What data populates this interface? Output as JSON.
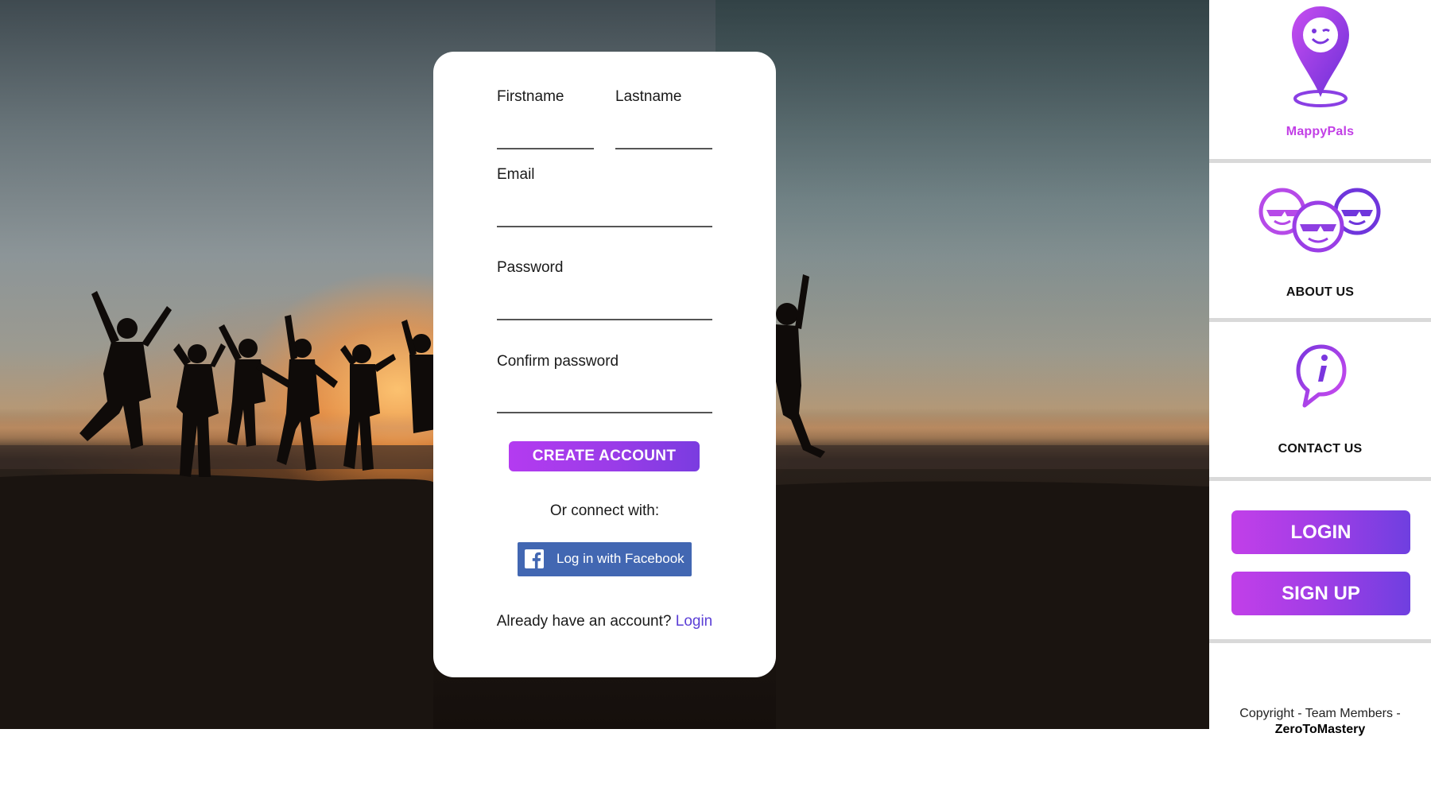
{
  "form": {
    "firstname_label": "Firstname",
    "lastname_label": "Lastname",
    "email_label": "Email",
    "password_label": "Password",
    "confirm_label": "Confirm password",
    "firstname_value": "",
    "lastname_value": "",
    "email_value": "",
    "password_value": "",
    "confirm_value": "",
    "create_button": "CREATE ACCOUNT",
    "connect_text": "Or connect with:",
    "facebook_button": "Log in with Facebook",
    "already_text": "Already have an account?",
    "login_link": "Login"
  },
  "sidebar": {
    "brand": "MappyPals",
    "about": "ABOUT US",
    "contact": "CONTACT US",
    "login_button": "LOGIN",
    "signup_button": "SIGN UP",
    "copyright_text": "Copyright - Team Members -",
    "copyright_org": "ZeroToMastery"
  },
  "icons": {
    "brand": "location-pin-smiley-icon",
    "about": "group-of-smileys-icon",
    "contact": "info-speech-bubble-icon",
    "facebook": "facebook-icon"
  },
  "colors": {
    "accent_purple": "#b43bf0",
    "accent_violet": "#6f3fe0",
    "facebook_blue": "#4267b2",
    "link_color": "#5b3fd6"
  }
}
